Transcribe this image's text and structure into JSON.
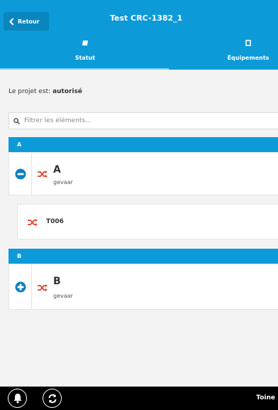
{
  "header": {
    "back_label": "Retour",
    "title": "Test CRC-1382_1",
    "tabs": [
      {
        "label": "Statut",
        "icon": "tag-icon"
      },
      {
        "label": "Équipements",
        "icon": "box-icon"
      }
    ],
    "bg_color": "#0d9ad9"
  },
  "status": {
    "prefix": "Le projet est:",
    "value": "autorisé"
  },
  "search": {
    "placeholder": "Filtrer les éléments..."
  },
  "groups": [
    {
      "header": "A",
      "item": {
        "name": "A",
        "subtitle": "gevaar",
        "toggle_icon": "minus-circle-icon"
      },
      "children": [
        {
          "name": "T006"
        }
      ]
    },
    {
      "header": "B",
      "item": {
        "name": "B",
        "subtitle": "gevaar",
        "toggle_icon": "plus-circle-icon"
      },
      "children": []
    }
  ],
  "footer": {
    "user": "Toine",
    "buttons": [
      "bell-icon",
      "refresh-icon"
    ]
  },
  "colors": {
    "accent": "#0d9ad9",
    "shuffle": "#e8432e",
    "footer": "#000000"
  }
}
